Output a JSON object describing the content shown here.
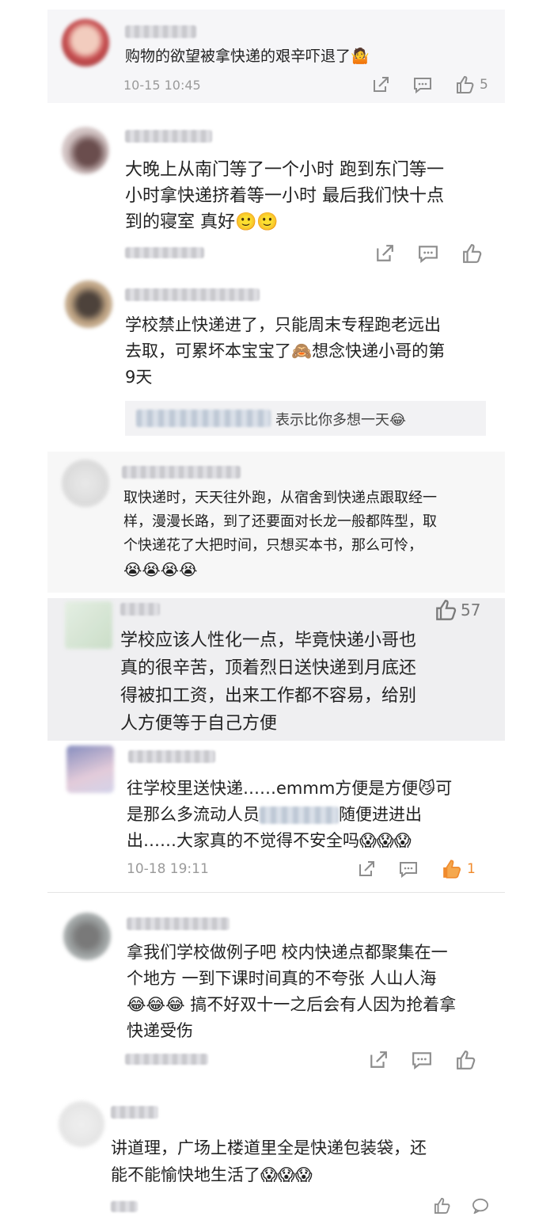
{
  "comments": [
    {
      "text": "购物的欲望被拿快递的艰辛吓退了",
      "emoji": "🤷",
      "timestamp": "10-15 10:45",
      "likes": "5"
    },
    {
      "text_lines": [
        "大晚上从南门等了一个小时 跑到东门等一",
        "小时拿快递挤着等一小时 最后我们快十点",
        "到的寝室 真好"
      ],
      "emoji": "🙂🙂"
    },
    {
      "text_lines": [
        "学校禁止快递进了，只能周末专程跑老远出",
        "去取，可累坏本宝宝了",
        "想念快递小哥的第",
        "9天"
      ],
      "emoji": "🙈",
      "reply": "表示比你多想一天",
      "reply_emoji": "😂"
    },
    {
      "text_lines": [
        "取快递时，天天往外跑，从宿舍到快递点跟取经一",
        "样，漫漫长路，到了还要面对长龙一般都阵型，取",
        "个快递花了大把时间，只想买本书，那么可怜，"
      ],
      "emoji": "😭😭😭😭"
    },
    {
      "likes": "57",
      "text_lines": [
        "学校应该人性化一点，毕竟快递小哥也",
        "真的很辛苦，顶着烈日送快递到月底还",
        "得被扣工资，出来工作都不容易，给别",
        "人方便等于自己方便"
      ]
    },
    {
      "text_lines": [
        "往学校里送快递……emmm方便是方便",
        "可",
        "是那么多流动人员",
        "随便进进出",
        "出……大家真的不觉得不安全吗"
      ],
      "emoji1": "😼",
      "emoji2": "😱😱😱",
      "timestamp": "10-18 19:11",
      "likes": "1"
    },
    {
      "text_lines": [
        "拿我们学校做例子吧 校内快递点都聚集在一",
        "个地方 一到下课时间真的不夸张 人山人海",
        "搞不好双十一之后会有人因为抢着拿",
        "快递受伤"
      ],
      "emoji": "😂😂😂"
    },
    {
      "text_lines": [
        "讲道理，广场上楼道里全是快递包装袋，还",
        "能不能愉快地生活了"
      ],
      "emoji": "😱😱😱"
    }
  ],
  "icons": {
    "share": "share-icon",
    "comment": "comment-icon",
    "like": "thumbs-up-icon",
    "reply": "speech-bubble-icon"
  },
  "colors": {
    "like_active": "#f08a2c",
    "icon_gray": "#8d8d8d",
    "meta_gray": "#9a9a9a"
  }
}
